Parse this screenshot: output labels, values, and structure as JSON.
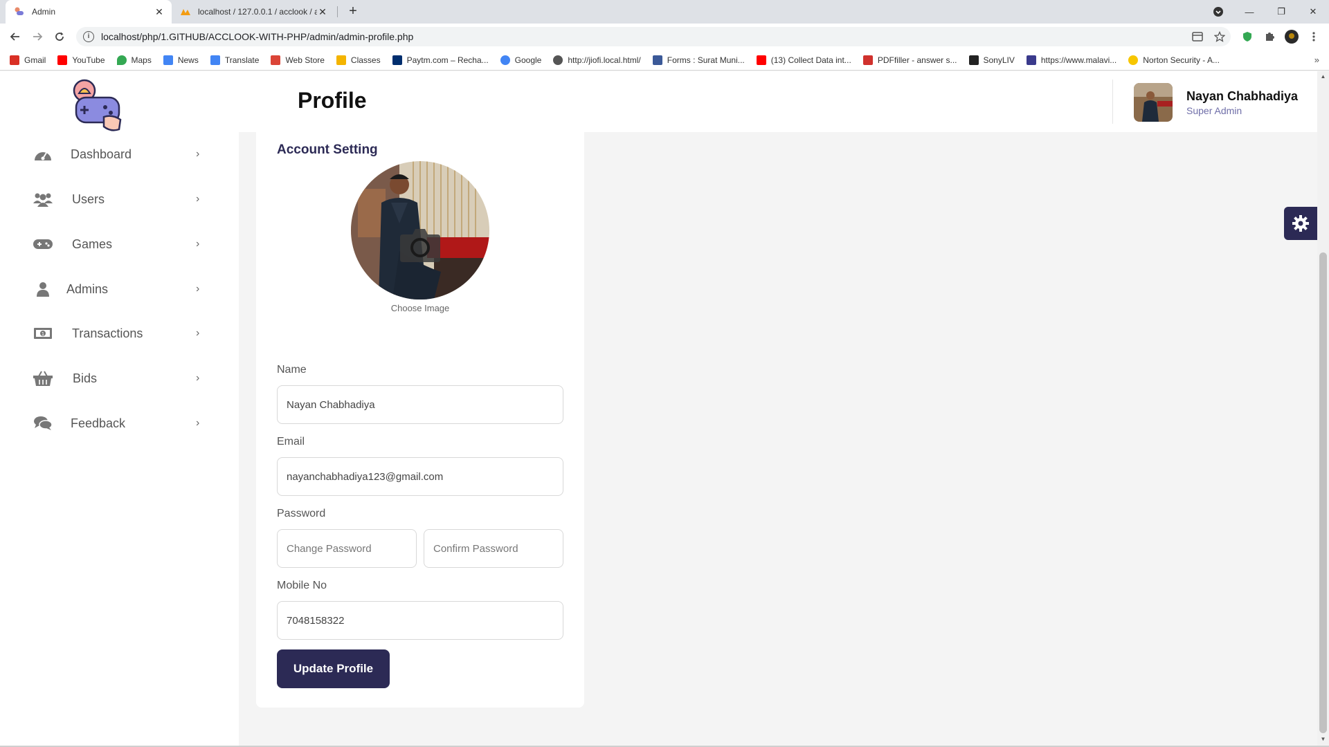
{
  "browser": {
    "tabs": [
      {
        "title": "Admin",
        "icon": "gamepad-icon"
      },
      {
        "title": "localhost / 127.0.0.1 / acclook / a",
        "icon": "phpmyadmin-icon"
      }
    ],
    "url": "localhost/php/1.GITHUB/ACCLOOK-WITH-PHP/admin/admin-profile.php",
    "bookmarks": [
      {
        "label": "Gmail",
        "color": "#d93025"
      },
      {
        "label": "YouTube",
        "color": "#ff0000"
      },
      {
        "label": "Maps",
        "color": "#34a853"
      },
      {
        "label": "News",
        "color": "#4285f4"
      },
      {
        "label": "Translate",
        "color": "#4285f4"
      },
      {
        "label": "Web Store",
        "color": "#db4437"
      },
      {
        "label": "Classes",
        "color": "#f4b400"
      },
      {
        "label": "Paytm.com – Recha...",
        "color": "#002e6e"
      },
      {
        "label": "Google",
        "color": "#4285f4"
      },
      {
        "label": "http://jiofi.local.html/",
        "color": "#555555"
      },
      {
        "label": "Forms : Surat Muni...",
        "color": "#3b5998"
      },
      {
        "label": "(13) Collect Data int...",
        "color": "#ff0000"
      },
      {
        "label": "PDFfiller - answer s...",
        "color": "#d0312d"
      },
      {
        "label": "SonyLIV",
        "color": "#222222"
      },
      {
        "label": "https://www.malavi...",
        "color": "#3a3a8c"
      },
      {
        "label": "Norton Security - A...",
        "color": "#f7c600"
      }
    ]
  },
  "sidebar": {
    "items": [
      {
        "label": "Dashboard",
        "icon": "dashboard-icon"
      },
      {
        "label": "Users",
        "icon": "users-icon"
      },
      {
        "label": "Games",
        "icon": "gamepad-icon"
      },
      {
        "label": "Admins",
        "icon": "user-icon"
      },
      {
        "label": "Transactions",
        "icon": "money-icon"
      },
      {
        "label": "Bids",
        "icon": "basket-icon"
      },
      {
        "label": "Feedback",
        "icon": "comments-icon"
      }
    ]
  },
  "header": {
    "title": "Profile",
    "user_name": "Nayan Chabhadiya",
    "user_role": "Super Admin"
  },
  "form": {
    "title": "Account Setting",
    "choose_image": "Choose Image",
    "name_label": "Name",
    "name_value": "Nayan Chabhadiya",
    "email_label": "Email",
    "email_value": "nayanchabhadiya123@gmail.com",
    "password_label": "Password",
    "password_placeholder": "Change Password",
    "confirm_placeholder": "Confirm Password",
    "mobile_label": "Mobile No",
    "mobile_value": "7048158322",
    "submit_label": "Update Profile"
  },
  "colors": {
    "accent": "#2c2a55",
    "role": "#6f6ea8"
  }
}
